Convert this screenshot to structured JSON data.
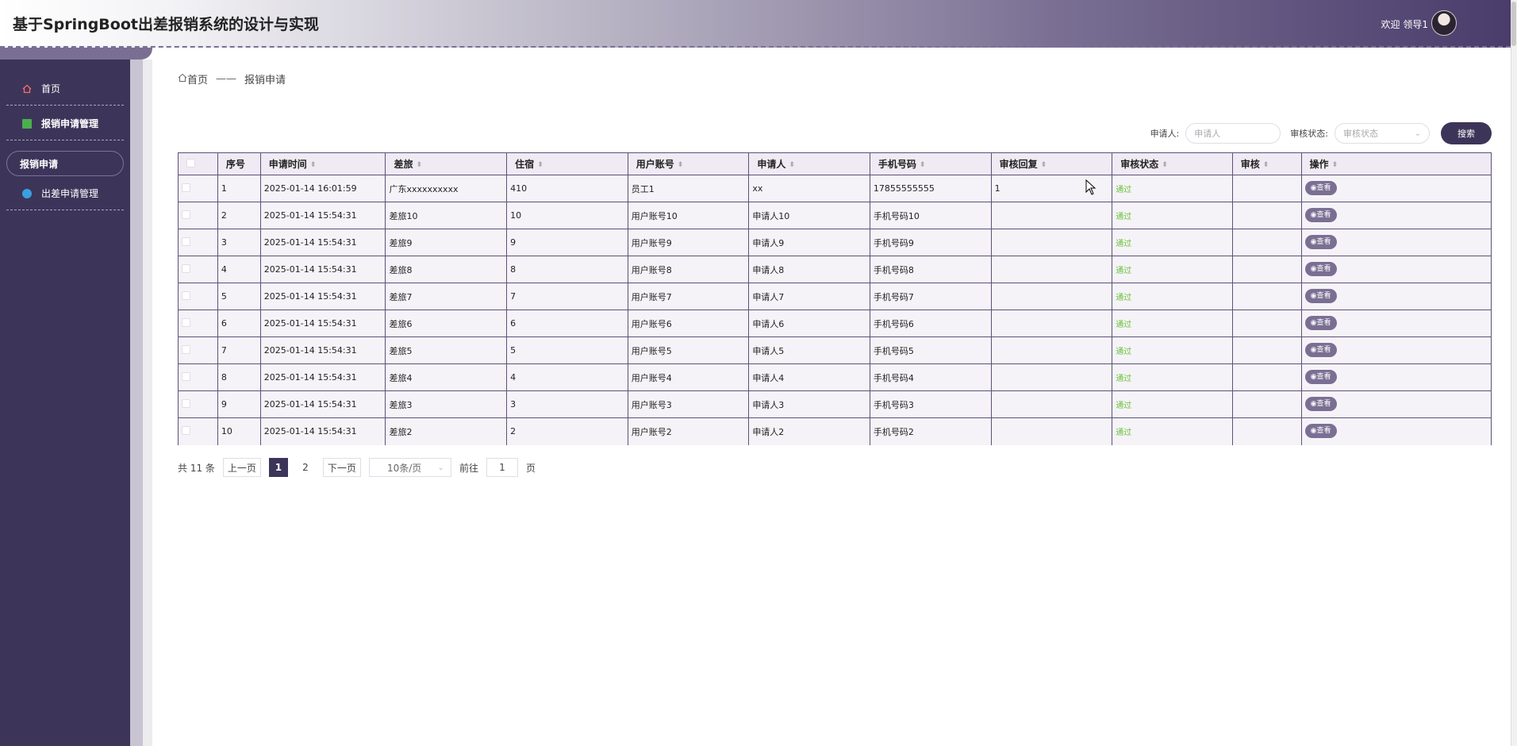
{
  "header": {
    "title": "基于SpringBoot出差报销系统的设计与实现",
    "welcome": "欢迎 领导1"
  },
  "sidebar": {
    "items": [
      {
        "label": "首页",
        "icon": "home-icon"
      },
      {
        "label": "报销申请管理",
        "icon": "square-icon"
      },
      {
        "label": "报销申请",
        "icon": ""
      },
      {
        "label": "出差申请管理",
        "icon": "circle-icon"
      }
    ]
  },
  "breadcrumb": {
    "home": "首页",
    "sep": "——",
    "current": "报销申请"
  },
  "search": {
    "applicant_label": "申请人:",
    "applicant_placeholder": "申请人",
    "status_label": "审核状态:",
    "status_placeholder": "审核状态",
    "button": "搜索"
  },
  "table": {
    "columns": [
      "序号",
      "申请时间",
      "差旅",
      "住宿",
      "用户账号",
      "申请人",
      "手机号码",
      "审核回复",
      "审核状态",
      "审核",
      "操作"
    ],
    "rows": [
      {
        "no": "1",
        "time": "2025-01-14 16:01:59",
        "trip": "广东xxxxxxxxxx",
        "lodging": "410",
        "account": "员工1",
        "applicant": "xx",
        "phone": "17855555555",
        "reply": "1",
        "status": "通过",
        "audit": "",
        "action": "查看"
      },
      {
        "no": "2",
        "time": "2025-01-14 15:54:31",
        "trip": "差旅10",
        "lodging": "10",
        "account": "用户账号10",
        "applicant": "申请人10",
        "phone": "手机号码10",
        "reply": "",
        "status": "通过",
        "audit": "",
        "action": "查看"
      },
      {
        "no": "3",
        "time": "2025-01-14 15:54:31",
        "trip": "差旅9",
        "lodging": "9",
        "account": "用户账号9",
        "applicant": "申请人9",
        "phone": "手机号码9",
        "reply": "",
        "status": "通过",
        "audit": "",
        "action": "查看"
      },
      {
        "no": "4",
        "time": "2025-01-14 15:54:31",
        "trip": "差旅8",
        "lodging": "8",
        "account": "用户账号8",
        "applicant": "申请人8",
        "phone": "手机号码8",
        "reply": "",
        "status": "通过",
        "audit": "",
        "action": "查看"
      },
      {
        "no": "5",
        "time": "2025-01-14 15:54:31",
        "trip": "差旅7",
        "lodging": "7",
        "account": "用户账号7",
        "applicant": "申请人7",
        "phone": "手机号码7",
        "reply": "",
        "status": "通过",
        "audit": "",
        "action": "查看"
      },
      {
        "no": "6",
        "time": "2025-01-14 15:54:31",
        "trip": "差旅6",
        "lodging": "6",
        "account": "用户账号6",
        "applicant": "申请人6",
        "phone": "手机号码6",
        "reply": "",
        "status": "通过",
        "audit": "",
        "action": "查看"
      },
      {
        "no": "7",
        "time": "2025-01-14 15:54:31",
        "trip": "差旅5",
        "lodging": "5",
        "account": "用户账号5",
        "applicant": "申请人5",
        "phone": "手机号码5",
        "reply": "",
        "status": "通过",
        "audit": "",
        "action": "查看"
      },
      {
        "no": "8",
        "time": "2025-01-14 15:54:31",
        "trip": "差旅4",
        "lodging": "4",
        "account": "用户账号4",
        "applicant": "申请人4",
        "phone": "手机号码4",
        "reply": "",
        "status": "通过",
        "audit": "",
        "action": "查看"
      },
      {
        "no": "9",
        "time": "2025-01-14 15:54:31",
        "trip": "差旅3",
        "lodging": "3",
        "account": "用户账号3",
        "applicant": "申请人3",
        "phone": "手机号码3",
        "reply": "",
        "status": "通过",
        "audit": "",
        "action": "查看"
      },
      {
        "no": "10",
        "time": "2025-01-14 15:54:31",
        "trip": "差旅2",
        "lodging": "2",
        "account": "用户账号2",
        "applicant": "申请人2",
        "phone": "手机号码2",
        "reply": "",
        "status": "通过",
        "audit": "",
        "action": "查看"
      }
    ]
  },
  "pagination": {
    "total": "共 11 条",
    "prev": "上一页",
    "pages": [
      "1",
      "2"
    ],
    "next": "下一页",
    "page_size": "10条/页",
    "goto_label": "前往",
    "goto_value": "1",
    "page_unit": "页"
  },
  "colors": {
    "primary": "#3d3559",
    "accent": "#7a6f93",
    "status_ok": "#67c23a"
  }
}
